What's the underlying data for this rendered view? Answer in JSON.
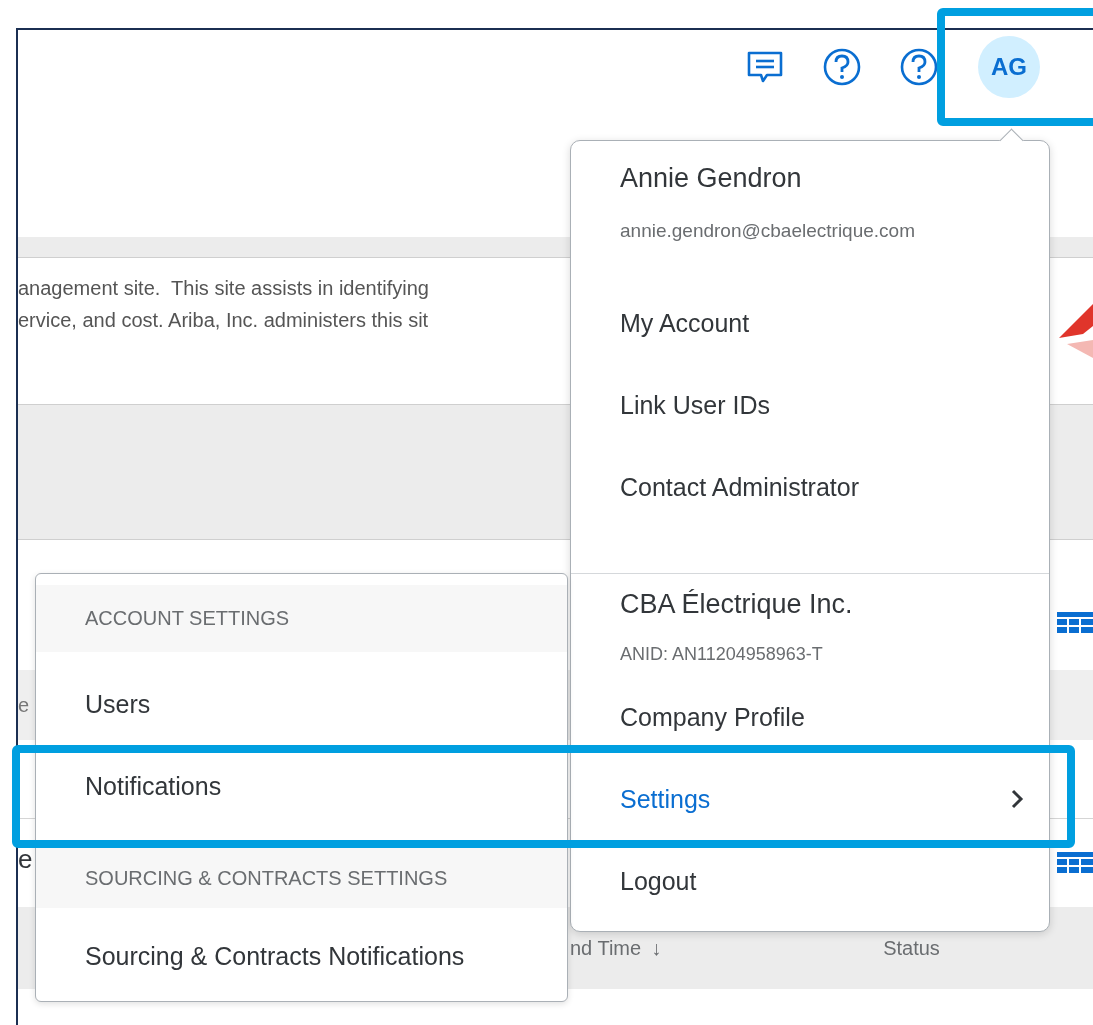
{
  "header": {
    "icons": [
      {
        "kind": "chat"
      },
      {
        "kind": "help"
      },
      {
        "kind": "help"
      }
    ],
    "avatar": {
      "initials": "AG"
    }
  },
  "page": {
    "intro_lines": [
      "anagement site.  This site assists in identifying",
      "ervice, and cost. Ariba, Inc. administers this sit"
    ],
    "fragments": [
      "e",
      "e"
    ],
    "table_header": {
      "column_end_time": "nd Time",
      "sort_indicator": "↓",
      "column_status": "Status"
    }
  },
  "user_menu": {
    "name": "Annie Gendron",
    "email": "annie.gendron@cbaelectrique.com",
    "items": [
      {
        "label": "My Account",
        "selected": false,
        "submenu": false
      },
      {
        "label": "Link User IDs",
        "selected": false,
        "submenu": false
      },
      {
        "label": "Contact Administrator",
        "selected": false,
        "submenu": false
      }
    ],
    "company": {
      "name": "CBA Électrique Inc.",
      "anid": "ANID: AN11204958963-T"
    },
    "company_items": [
      {
        "label": "Company Profile",
        "selected": false,
        "submenu": false
      },
      {
        "label": "Settings",
        "selected": true,
        "submenu": true
      },
      {
        "label": "Logout",
        "selected": false,
        "submenu": false
      }
    ]
  },
  "settings_submenu": {
    "sections": [
      {
        "header": "ACCOUNT SETTINGS",
        "items": [
          "Users",
          "Notifications"
        ]
      },
      {
        "header": "SOURCING & CONTRACTS SETTINGS",
        "items": [
          "Sourcing & Contracts Notifications"
        ]
      }
    ]
  }
}
